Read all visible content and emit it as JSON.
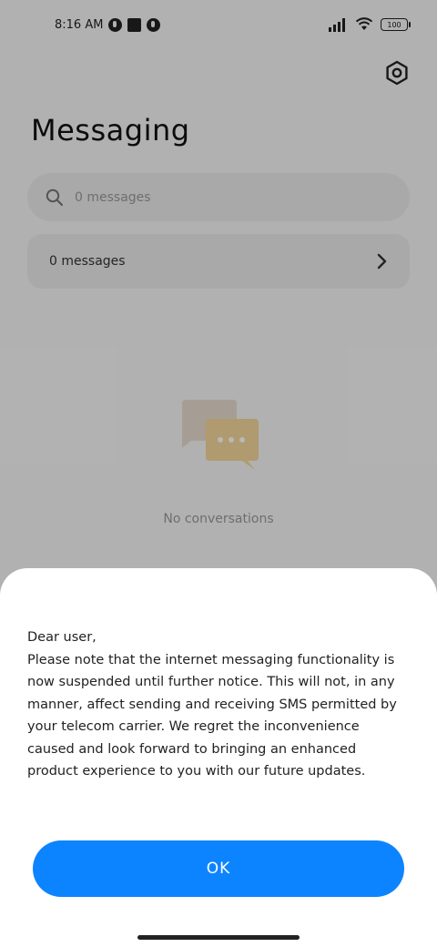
{
  "status_bar": {
    "time": "8:16 AM",
    "battery": "100"
  },
  "page": {
    "title": "Messaging"
  },
  "search": {
    "placeholder": "0 messages"
  },
  "summary": {
    "label": "0 messages"
  },
  "empty_state": {
    "text": "No conversations"
  },
  "dialog": {
    "greeting": "Dear user,",
    "body": "Please note that the internet messaging functionality is now suspended until further notice. This will not, in any manner, affect sending and receiving SMS permitted by your telecom carrier. We regret the inconvenience caused and look forward to bringing an enhanced product experience to you with our future updates.",
    "ok_label": "OK"
  },
  "colors": {
    "accent": "#0d84ff",
    "illustration_back": "#e6dccd",
    "illustration_front": "#f3d79a"
  },
  "icons": {
    "settings": "settings-icon",
    "search": "search-icon",
    "chevron": "chevron-right-icon",
    "signal": "signal-icon",
    "wifi": "wifi-icon",
    "battery": "battery-icon"
  }
}
